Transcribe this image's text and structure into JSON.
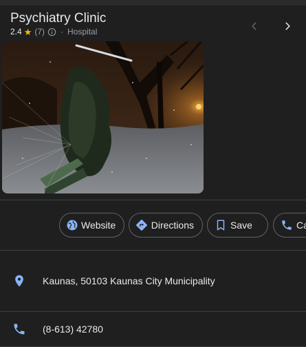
{
  "place": {
    "title": "Psychiatry Clinic",
    "rating": "2.4",
    "review_count": "(7)",
    "separator": "·",
    "category": "Hospital"
  },
  "icons": {
    "star": "star-icon",
    "info": "info-icon",
    "prev": "chevron-left-icon",
    "next": "chevron-right-icon",
    "website": "globe-icon",
    "directions": "directions-icon",
    "save": "bookmark-icon",
    "call": "phone-icon",
    "address": "location-pin-icon",
    "phone": "phone-icon"
  },
  "actions": {
    "website": "Website",
    "directions": "Directions",
    "save": "Save",
    "call": "Ca"
  },
  "details": {
    "address": "Kaunas, 50103 Kaunas City Municipality",
    "phone": "(8-613) 42780"
  },
  "colors": {
    "background": "#1f1f1f",
    "accent": "#8ab4f8",
    "star": "#fbbc04",
    "divider": "#3c4043",
    "muted_text": "#9aa0a6"
  }
}
